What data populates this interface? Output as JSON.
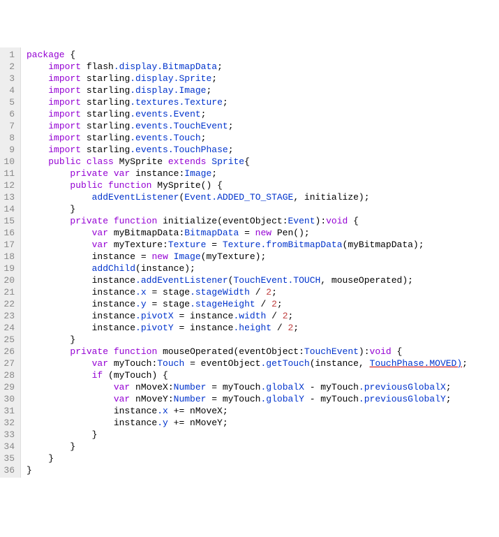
{
  "lines": [
    {
      "n": 1,
      "tokens": [
        {
          "t": "package",
          "c": "kw"
        },
        {
          "t": " {",
          "c": "plain"
        }
      ]
    },
    {
      "n": 2,
      "tokens": [
        {
          "t": "    ",
          "c": "plain"
        },
        {
          "t": "import",
          "c": "kw"
        },
        {
          "t": " flash",
          "c": "plain"
        },
        {
          "t": ".display.BitmapData",
          "c": "member"
        },
        {
          "t": ";",
          "c": "plain"
        }
      ]
    },
    {
      "n": 3,
      "tokens": [
        {
          "t": "    ",
          "c": "plain"
        },
        {
          "t": "import",
          "c": "kw"
        },
        {
          "t": " starling",
          "c": "plain"
        },
        {
          "t": ".display.Sprite",
          "c": "member"
        },
        {
          "t": ";",
          "c": "plain"
        }
      ]
    },
    {
      "n": 4,
      "tokens": [
        {
          "t": "    ",
          "c": "plain"
        },
        {
          "t": "import",
          "c": "kw"
        },
        {
          "t": " starling",
          "c": "plain"
        },
        {
          "t": ".display.Image",
          "c": "member"
        },
        {
          "t": ";",
          "c": "plain"
        }
      ]
    },
    {
      "n": 5,
      "tokens": [
        {
          "t": "    ",
          "c": "plain"
        },
        {
          "t": "import",
          "c": "kw"
        },
        {
          "t": " starling",
          "c": "plain"
        },
        {
          "t": ".textures.Texture",
          "c": "member"
        },
        {
          "t": ";",
          "c": "plain"
        }
      ]
    },
    {
      "n": 6,
      "tokens": [
        {
          "t": "    ",
          "c": "plain"
        },
        {
          "t": "import",
          "c": "kw"
        },
        {
          "t": " starling",
          "c": "plain"
        },
        {
          "t": ".events.Event",
          "c": "member"
        },
        {
          "t": ";",
          "c": "plain"
        }
      ]
    },
    {
      "n": 7,
      "tokens": [
        {
          "t": "    ",
          "c": "plain"
        },
        {
          "t": "import",
          "c": "kw"
        },
        {
          "t": " starling",
          "c": "plain"
        },
        {
          "t": ".events.TouchEvent",
          "c": "member"
        },
        {
          "t": ";",
          "c": "plain"
        }
      ]
    },
    {
      "n": 8,
      "tokens": [
        {
          "t": "    ",
          "c": "plain"
        },
        {
          "t": "import",
          "c": "kw"
        },
        {
          "t": " starling",
          "c": "plain"
        },
        {
          "t": ".events.Touch",
          "c": "member"
        },
        {
          "t": ";",
          "c": "plain"
        }
      ]
    },
    {
      "n": 9,
      "tokens": [
        {
          "t": "    ",
          "c": "plain"
        },
        {
          "t": "import",
          "c": "kw"
        },
        {
          "t": " starling",
          "c": "plain"
        },
        {
          "t": ".events.TouchPhase",
          "c": "member"
        },
        {
          "t": ";",
          "c": "plain"
        }
      ]
    },
    {
      "n": 10,
      "tokens": [
        {
          "t": "    ",
          "c": "plain"
        },
        {
          "t": "public",
          "c": "kw"
        },
        {
          "t": " ",
          "c": "plain"
        },
        {
          "t": "class",
          "c": "kw"
        },
        {
          "t": " MySprite ",
          "c": "plain"
        },
        {
          "t": "extends",
          "c": "kw"
        },
        {
          "t": " ",
          "c": "plain"
        },
        {
          "t": "Sprite",
          "c": "type"
        },
        {
          "t": "{",
          "c": "plain"
        }
      ]
    },
    {
      "n": 11,
      "tokens": [
        {
          "t": "        ",
          "c": "plain"
        },
        {
          "t": "private",
          "c": "kw"
        },
        {
          "t": " ",
          "c": "plain"
        },
        {
          "t": "var",
          "c": "kw"
        },
        {
          "t": " instance:",
          "c": "plain"
        },
        {
          "t": "Image",
          "c": "type"
        },
        {
          "t": ";",
          "c": "plain"
        }
      ]
    },
    {
      "n": 12,
      "tokens": [
        {
          "t": "        ",
          "c": "plain"
        },
        {
          "t": "public",
          "c": "kw"
        },
        {
          "t": " ",
          "c": "plain"
        },
        {
          "t": "function",
          "c": "kw"
        },
        {
          "t": " MySprite() {",
          "c": "plain"
        }
      ]
    },
    {
      "n": 13,
      "tokens": [
        {
          "t": "            ",
          "c": "plain"
        },
        {
          "t": "addEventListener",
          "c": "method"
        },
        {
          "t": "(",
          "c": "plain"
        },
        {
          "t": "Event",
          "c": "type"
        },
        {
          "t": ".ADDED_TO_STAGE",
          "c": "member"
        },
        {
          "t": ", initialize);",
          "c": "plain"
        }
      ]
    },
    {
      "n": 14,
      "tokens": [
        {
          "t": "        }",
          "c": "plain"
        }
      ]
    },
    {
      "n": 15,
      "tokens": [
        {
          "t": "        ",
          "c": "plain"
        },
        {
          "t": "private",
          "c": "kw"
        },
        {
          "t": " ",
          "c": "plain"
        },
        {
          "t": "function",
          "c": "kw"
        },
        {
          "t": " initialize(eventObject:",
          "c": "plain"
        },
        {
          "t": "Event",
          "c": "type"
        },
        {
          "t": "):",
          "c": "plain"
        },
        {
          "t": "void",
          "c": "kw"
        },
        {
          "t": " {",
          "c": "plain"
        }
      ]
    },
    {
      "n": 16,
      "tokens": [
        {
          "t": "            ",
          "c": "plain"
        },
        {
          "t": "var",
          "c": "kw"
        },
        {
          "t": " myBitmapData:",
          "c": "plain"
        },
        {
          "t": "BitmapData",
          "c": "type"
        },
        {
          "t": " = ",
          "c": "plain"
        },
        {
          "t": "new",
          "c": "kw"
        },
        {
          "t": " Pen();",
          "c": "plain"
        }
      ]
    },
    {
      "n": 17,
      "tokens": [
        {
          "t": "            ",
          "c": "plain"
        },
        {
          "t": "var",
          "c": "kw"
        },
        {
          "t": " myTexture:",
          "c": "plain"
        },
        {
          "t": "Texture",
          "c": "type"
        },
        {
          "t": " = ",
          "c": "plain"
        },
        {
          "t": "Texture",
          "c": "type"
        },
        {
          "t": ".fromBitmapData",
          "c": "member"
        },
        {
          "t": "(myBitmapData);",
          "c": "plain"
        }
      ]
    },
    {
      "n": 18,
      "tokens": [
        {
          "t": "            instance = ",
          "c": "plain"
        },
        {
          "t": "new",
          "c": "kw"
        },
        {
          "t": " ",
          "c": "plain"
        },
        {
          "t": "Image",
          "c": "type"
        },
        {
          "t": "(myTexture);",
          "c": "plain"
        }
      ]
    },
    {
      "n": 19,
      "tokens": [
        {
          "t": "            ",
          "c": "plain"
        },
        {
          "t": "addChild",
          "c": "method"
        },
        {
          "t": "(instance);",
          "c": "plain"
        }
      ]
    },
    {
      "n": 20,
      "tokens": [
        {
          "t": "            instance",
          "c": "plain"
        },
        {
          "t": ".addEventListener",
          "c": "member"
        },
        {
          "t": "(",
          "c": "plain"
        },
        {
          "t": "TouchEvent",
          "c": "type"
        },
        {
          "t": ".TOUCH",
          "c": "member"
        },
        {
          "t": ", mouseOperated);",
          "c": "plain"
        }
      ]
    },
    {
      "n": 21,
      "tokens": [
        {
          "t": "            instance",
          "c": "plain"
        },
        {
          "t": ".x",
          "c": "member"
        },
        {
          "t": " = stage",
          "c": "plain"
        },
        {
          "t": ".stageWidth",
          "c": "member"
        },
        {
          "t": " / ",
          "c": "plain"
        },
        {
          "t": "2",
          "c": "num"
        },
        {
          "t": ";",
          "c": "plain"
        }
      ]
    },
    {
      "n": 22,
      "tokens": [
        {
          "t": "            instance",
          "c": "plain"
        },
        {
          "t": ".y",
          "c": "member"
        },
        {
          "t": " = stage",
          "c": "plain"
        },
        {
          "t": ".stageHeight",
          "c": "member"
        },
        {
          "t": " / ",
          "c": "plain"
        },
        {
          "t": "2",
          "c": "num"
        },
        {
          "t": ";",
          "c": "plain"
        }
      ]
    },
    {
      "n": 23,
      "tokens": [
        {
          "t": "            instance",
          "c": "plain"
        },
        {
          "t": ".pivotX",
          "c": "member"
        },
        {
          "t": " = instance",
          "c": "plain"
        },
        {
          "t": ".width",
          "c": "member"
        },
        {
          "t": " / ",
          "c": "plain"
        },
        {
          "t": "2",
          "c": "num"
        },
        {
          "t": ";",
          "c": "plain"
        }
      ]
    },
    {
      "n": 24,
      "tokens": [
        {
          "t": "            instance",
          "c": "plain"
        },
        {
          "t": ".pivotY",
          "c": "member"
        },
        {
          "t": " = instance",
          "c": "plain"
        },
        {
          "t": ".height",
          "c": "member"
        },
        {
          "t": " / ",
          "c": "plain"
        },
        {
          "t": "2",
          "c": "num"
        },
        {
          "t": ";",
          "c": "plain"
        }
      ]
    },
    {
      "n": 25,
      "tokens": [
        {
          "t": "        }",
          "c": "plain"
        }
      ]
    },
    {
      "n": 26,
      "tokens": [
        {
          "t": "        ",
          "c": "plain"
        },
        {
          "t": "private",
          "c": "kw"
        },
        {
          "t": " ",
          "c": "plain"
        },
        {
          "t": "function",
          "c": "kw"
        },
        {
          "t": " mouseOperated(eventObject:",
          "c": "plain"
        },
        {
          "t": "TouchEvent",
          "c": "type"
        },
        {
          "t": "):",
          "c": "plain"
        },
        {
          "t": "void",
          "c": "kw"
        },
        {
          "t": " {",
          "c": "plain"
        }
      ]
    },
    {
      "n": 27,
      "tokens": [
        {
          "t": "            ",
          "c": "plain"
        },
        {
          "t": "var",
          "c": "kw"
        },
        {
          "t": " myTouch:",
          "c": "plain"
        },
        {
          "t": "Touch",
          "c": "type"
        },
        {
          "t": " = eventObject",
          "c": "plain"
        },
        {
          "t": ".getTouch",
          "c": "member"
        },
        {
          "t": "(instance, ",
          "c": "plain"
        },
        {
          "t": "TouchPhase",
          "c": "type underline-red"
        },
        {
          "t": ".MOVED)",
          "c": "member underline-red"
        },
        {
          "t": ";",
          "c": "plain"
        }
      ]
    },
    {
      "n": 28,
      "tokens": [
        {
          "t": "            ",
          "c": "plain"
        },
        {
          "t": "if",
          "c": "kw"
        },
        {
          "t": " (myTouch) {",
          "c": "plain"
        }
      ]
    },
    {
      "n": 29,
      "tokens": [
        {
          "t": "                ",
          "c": "plain"
        },
        {
          "t": "var",
          "c": "kw"
        },
        {
          "t": " nMoveX:",
          "c": "plain"
        },
        {
          "t": "Number",
          "c": "type"
        },
        {
          "t": " = myTouch",
          "c": "plain"
        },
        {
          "t": ".globalX",
          "c": "member"
        },
        {
          "t": " - myTouch",
          "c": "plain"
        },
        {
          "t": ".previousGlobalX",
          "c": "member"
        },
        {
          "t": ";",
          "c": "plain"
        }
      ]
    },
    {
      "n": 30,
      "tokens": [
        {
          "t": "                ",
          "c": "plain"
        },
        {
          "t": "var",
          "c": "kw"
        },
        {
          "t": " nMoveY:",
          "c": "plain"
        },
        {
          "t": "Number",
          "c": "type"
        },
        {
          "t": " = myTouch",
          "c": "plain"
        },
        {
          "t": ".globalY",
          "c": "member"
        },
        {
          "t": " - myTouch",
          "c": "plain"
        },
        {
          "t": ".previousGlobalY",
          "c": "member"
        },
        {
          "t": ";",
          "c": "plain"
        }
      ]
    },
    {
      "n": 31,
      "tokens": [
        {
          "t": "                instance",
          "c": "plain"
        },
        {
          "t": ".x",
          "c": "member"
        },
        {
          "t": " += nMoveX;",
          "c": "plain"
        }
      ]
    },
    {
      "n": 32,
      "tokens": [
        {
          "t": "                instance",
          "c": "plain"
        },
        {
          "t": ".y",
          "c": "member"
        },
        {
          "t": " += nMoveY;",
          "c": "plain"
        }
      ]
    },
    {
      "n": 33,
      "tokens": [
        {
          "t": "            }",
          "c": "plain"
        }
      ]
    },
    {
      "n": 34,
      "tokens": [
        {
          "t": "        }",
          "c": "plain"
        }
      ]
    },
    {
      "n": 35,
      "tokens": [
        {
          "t": "    }",
          "c": "plain"
        }
      ]
    },
    {
      "n": 36,
      "tokens": [
        {
          "t": "}",
          "c": "plain"
        }
      ]
    }
  ]
}
